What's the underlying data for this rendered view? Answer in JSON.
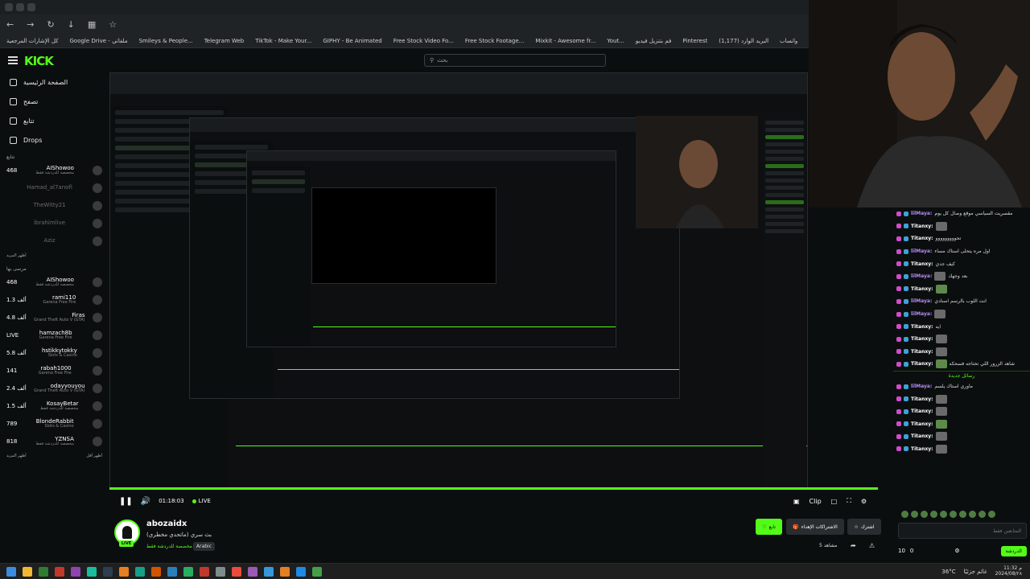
{
  "browser": {
    "bookmarks": [
      "كل الإشارات المرجعية",
      "Google Drive - ملفاتي",
      "Smileys & People...",
      "Telegram Web",
      "TikTok - Make Your...",
      "GIPHY - Be Animated",
      "Free Stock Video Fo...",
      "Free Stock Footage...",
      "Mixkit - Awesome fr...",
      "Yout...",
      "فم بتنزيل فيديو",
      "Pinterest",
      "(1,177) البريد الوارد",
      "واتساب"
    ]
  },
  "header": {
    "logo": "KICK",
    "search_placeholder": "بحث"
  },
  "sidebar": {
    "nav": [
      {
        "label": "الصفحة الرئيسية",
        "icon": "home-icon"
      },
      {
        "label": "تصفح",
        "icon": "browse-icon"
      },
      {
        "label": "تتابع",
        "icon": "heart-icon"
      },
      {
        "label": "Drops",
        "icon": "drops-icon"
      }
    ],
    "following_title": "تتابع",
    "following": [
      {
        "name": "AIShowoo",
        "count": "468",
        "cat": "مخصصة للدردشة فقط",
        "live": true
      },
      {
        "name": "Hamad_al7anofi",
        "count": "",
        "cat": "",
        "live": false
      },
      {
        "name": "TheWitty21",
        "count": "",
        "cat": "",
        "live": false
      },
      {
        "name": "ibrahimlive",
        "count": "",
        "cat": "",
        "live": false
      },
      {
        "name": "Aziz",
        "count": "",
        "cat": "",
        "live": false
      }
    ],
    "more_following": "أظهر المزيد",
    "recommended_title": "مرسى بها",
    "recommended": [
      {
        "name": "AIShowoo",
        "count": "468",
        "cat": "مخصصة للدردشة فقط"
      },
      {
        "name": "rami110",
        "count": "1.3 ألف",
        "cat": "Garena Free Fire"
      },
      {
        "name": "Firas",
        "count": "4.8 ألف",
        "cat": "Grand Theft Auto V (GTA)"
      },
      {
        "name": "hamzach8b",
        "count": "LIVE",
        "cat": "Garena Free Fire"
      },
      {
        "name": "hstikkytokky",
        "count": "5.8 ألف",
        "cat": "Slots & Casino"
      },
      {
        "name": "rabah1000",
        "count": "141",
        "cat": "Garena Free Fire"
      },
      {
        "name": "odayyouyou",
        "count": "2.4 ألف",
        "cat": "Grand Theft Auto V (GTA)"
      },
      {
        "name": "KosayBetar",
        "count": "1.5 ألف",
        "cat": "مخصصة للدردشة فقط"
      },
      {
        "name": "BlondeRabbit",
        "count": "789",
        "cat": "Slots & Casino"
      },
      {
        "name": "YZNSA",
        "count": "818",
        "cat": "مخصصة للدردشة فقط"
      }
    ],
    "more_recommended": "أظهر المزيد",
    "less_recommended": "أظهر أقل"
  },
  "player": {
    "time": "01:18:03",
    "live_label": "LIVE",
    "clip_label": "Clip"
  },
  "stream": {
    "streamer": "abozaidx",
    "title": "بث سري (ماتحدي مخطري)",
    "category": "مخصصة للدردشة فقط",
    "language": "Arabic",
    "live_badge": "LIVE",
    "viewers": "5 مشاهد",
    "follow_label": "تابع",
    "subs_label": "الاشتراكات الإهداء",
    "subscribe_label": "اشترك"
  },
  "chat": {
    "messages": [
      {
        "user": "lilMaya:",
        "style": "p",
        "text": "مقسريت السياسي موقع وصال كل يوم",
        "emote": false
      },
      {
        "user": "Titanxy:",
        "style": "w",
        "text": "",
        "emote": true
      },
      {
        "user": "Titanxy:",
        "style": "w",
        "text": "تحووووووووو",
        "emote": false
      },
      {
        "user": "lilMaya:",
        "style": "p",
        "text": "اول مره يتحلى استاك مساء",
        "emote": false
      },
      {
        "user": "Titanxy:",
        "style": "w",
        "text": "كيف جدي",
        "emote": false
      },
      {
        "user": "lilMaya:",
        "style": "p",
        "text": "بعد وجهك",
        "emote": true
      },
      {
        "user": "Titanxy:",
        "style": "w",
        "text": "",
        "emote": true
      },
      {
        "user": "lilMaya:",
        "style": "p",
        "text": "انت اللوب بالرسم اسنادي",
        "emote": false
      },
      {
        "user": "lilMaya:",
        "style": "p",
        "text": "",
        "emote": true
      },
      {
        "user": "Titanxy:",
        "style": "w",
        "text": "ايه",
        "emote": false
      },
      {
        "user": "Titanxy:",
        "style": "w",
        "text": "",
        "emote": true
      },
      {
        "user": "Titanxy:",
        "style": "w",
        "text": "",
        "emote": true
      },
      {
        "user": "Titanxy:",
        "style": "w",
        "text": "شاهد الزرور اللي تحتاجه فسحكه",
        "emote": true
      }
    ],
    "divider": "رسائل جديدة",
    "messages2": [
      {
        "user": "lilMaya:",
        "style": "p",
        "text": "ماوري استاك يلسم",
        "emote": false
      },
      {
        "user": "Titanxy:",
        "style": "w",
        "text": "",
        "emote": true
      },
      {
        "user": "Titanxy:",
        "style": "w",
        "text": "",
        "emote": true
      },
      {
        "user": "Titanxy:",
        "style": "w",
        "text": "",
        "emote": true
      },
      {
        "user": "Titanxy:",
        "style": "w",
        "text": "",
        "emote": true
      },
      {
        "user": "Titanxy:",
        "style": "w",
        "text": "",
        "emote": true
      }
    ],
    "input_placeholder": "المتابعين فقط",
    "kicks": "10",
    "points": "0",
    "send_label": "الدردشة"
  },
  "taskbar": {
    "weather": "36°C",
    "weather_label": "غائم جزئيًا",
    "time": "11:32 م",
    "date": "2024/08/٢٨",
    "icon_colors": [
      "#3a8dde",
      "#f2b632",
      "#2e7d32",
      "#c0392b",
      "#8e44ad",
      "#1abc9c",
      "#2c3e50",
      "#e67e22",
      "#16a085",
      "#d35400",
      "#2980b9",
      "#27ae60",
      "#c0392b",
      "#7f8c8d",
      "#e74c3c",
      "#9b59b6",
      "#3498db",
      "#e67e22",
      "#1e88e5",
      "#43a047"
    ]
  }
}
